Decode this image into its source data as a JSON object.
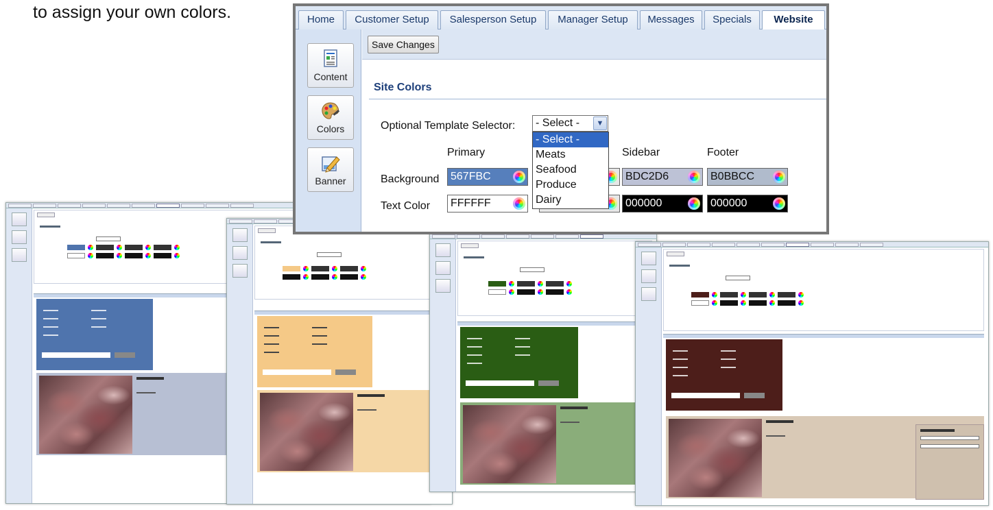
{
  "caption": "to assign your own colors.",
  "window": {
    "tabs": [
      {
        "label": "Home"
      },
      {
        "label": "Customer Setup"
      },
      {
        "label": "Salesperson Setup"
      },
      {
        "label": "Manager Setup"
      },
      {
        "label": "Messages"
      },
      {
        "label": "Specials"
      },
      {
        "label": "Website"
      }
    ],
    "active_tab": "Website",
    "sidebar": [
      {
        "label": "Content",
        "icon": "document-icon"
      },
      {
        "label": "Colors",
        "icon": "palette-icon"
      },
      {
        "label": "Banner",
        "icon": "banner-edit-icon"
      }
    ],
    "save_label": "Save Changes",
    "section_title": "Site Colors",
    "template_selector": {
      "label": "Optional Template Selector:",
      "value": "- Select -",
      "options": [
        "- Select -",
        "Meats",
        "Seafood",
        "Produce",
        "Dairy"
      ],
      "highlighted": "- Select -"
    },
    "columns": [
      "Primary",
      "Sidebar",
      "Footer"
    ],
    "rows": {
      "background": {
        "label": "Background",
        "primary": {
          "value": "567FBC",
          "bg": "#567FBC",
          "fg": "#FFFFFF"
        },
        "sidebar": {
          "value": "BDC2D6",
          "bg": "#BDC2D6",
          "fg": "#111111"
        },
        "footer": {
          "value": "B0BBCC",
          "bg": "#B0BBCC",
          "fg": "#111111"
        }
      },
      "text": {
        "label": "Text Color",
        "primary": {
          "value": "FFFFFF",
          "bg": "#FFFFFF",
          "fg": "#111111"
        },
        "sidebar": {
          "value": "000000",
          "bg": "#000000",
          "fg": "#FFFFFF"
        },
        "footer": {
          "value": "000000",
          "bg": "#000000",
          "fg": "#FFFFFF"
        }
      }
    }
  },
  "previews": [
    {
      "theme": "Seafood",
      "primary": "#4f74ad",
      "content": "#b7bfd3"
    },
    {
      "theme": "Produce",
      "primary": "#f5c987",
      "content": "#f5d7a6"
    },
    {
      "theme": "Meats",
      "primary": "#2a5d14",
      "content": "#8aad7a"
    },
    {
      "theme": "Dairy",
      "primary": "#4d1e1a",
      "content": "#d9c9b6"
    }
  ]
}
